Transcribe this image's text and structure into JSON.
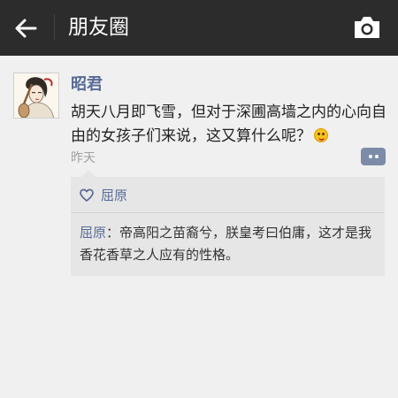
{
  "header": {
    "back_icon": "back-arrow-icon",
    "title": "朋友圈",
    "camera_icon": "camera-icon",
    "background": "#2c2c2c"
  },
  "post": {
    "author": "昭君",
    "content": "胡天八月即飞雪，但对于深圃高墙之内的心向自由的女孩子们来说，这又算什么呢？",
    "emoji_icon": "smile-emoji-icon",
    "time": "昨天",
    "comment_icon": "comment-more-icon",
    "likes": {
      "icon": "heart-icon",
      "names": "屈原"
    },
    "comments": [
      {
        "author": "屈原",
        "separator": "：",
        "text": "帝高阳之苗裔兮，朕皇考曰伯庸，这才是我香花香草之人应有的性格。"
      }
    ]
  },
  "colors": {
    "link": "#576b95",
    "time": "#a0a0a0",
    "panel": "#e6e6e6"
  }
}
